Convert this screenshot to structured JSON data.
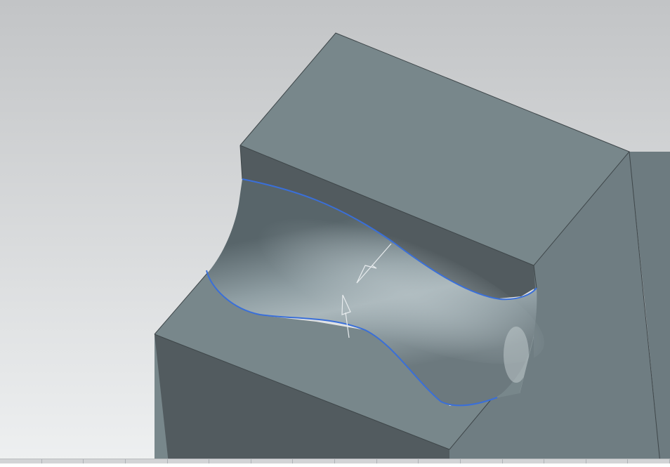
{
  "colors": {
    "background_top": "#c2c4c6",
    "background_bottom": "#eef0f1",
    "face_top": "#78878b",
    "face_side_right": "#6d7b80",
    "face_front_left": "#525b5f",
    "face_back_wall": "#525b5f",
    "curve_highlight": "#3a6fd8",
    "vector_arrow": "#e8ecee"
  },
  "icons": {
    "normal_vector_1": "arrow-icon",
    "normal_vector_2": "arrow-icon"
  }
}
